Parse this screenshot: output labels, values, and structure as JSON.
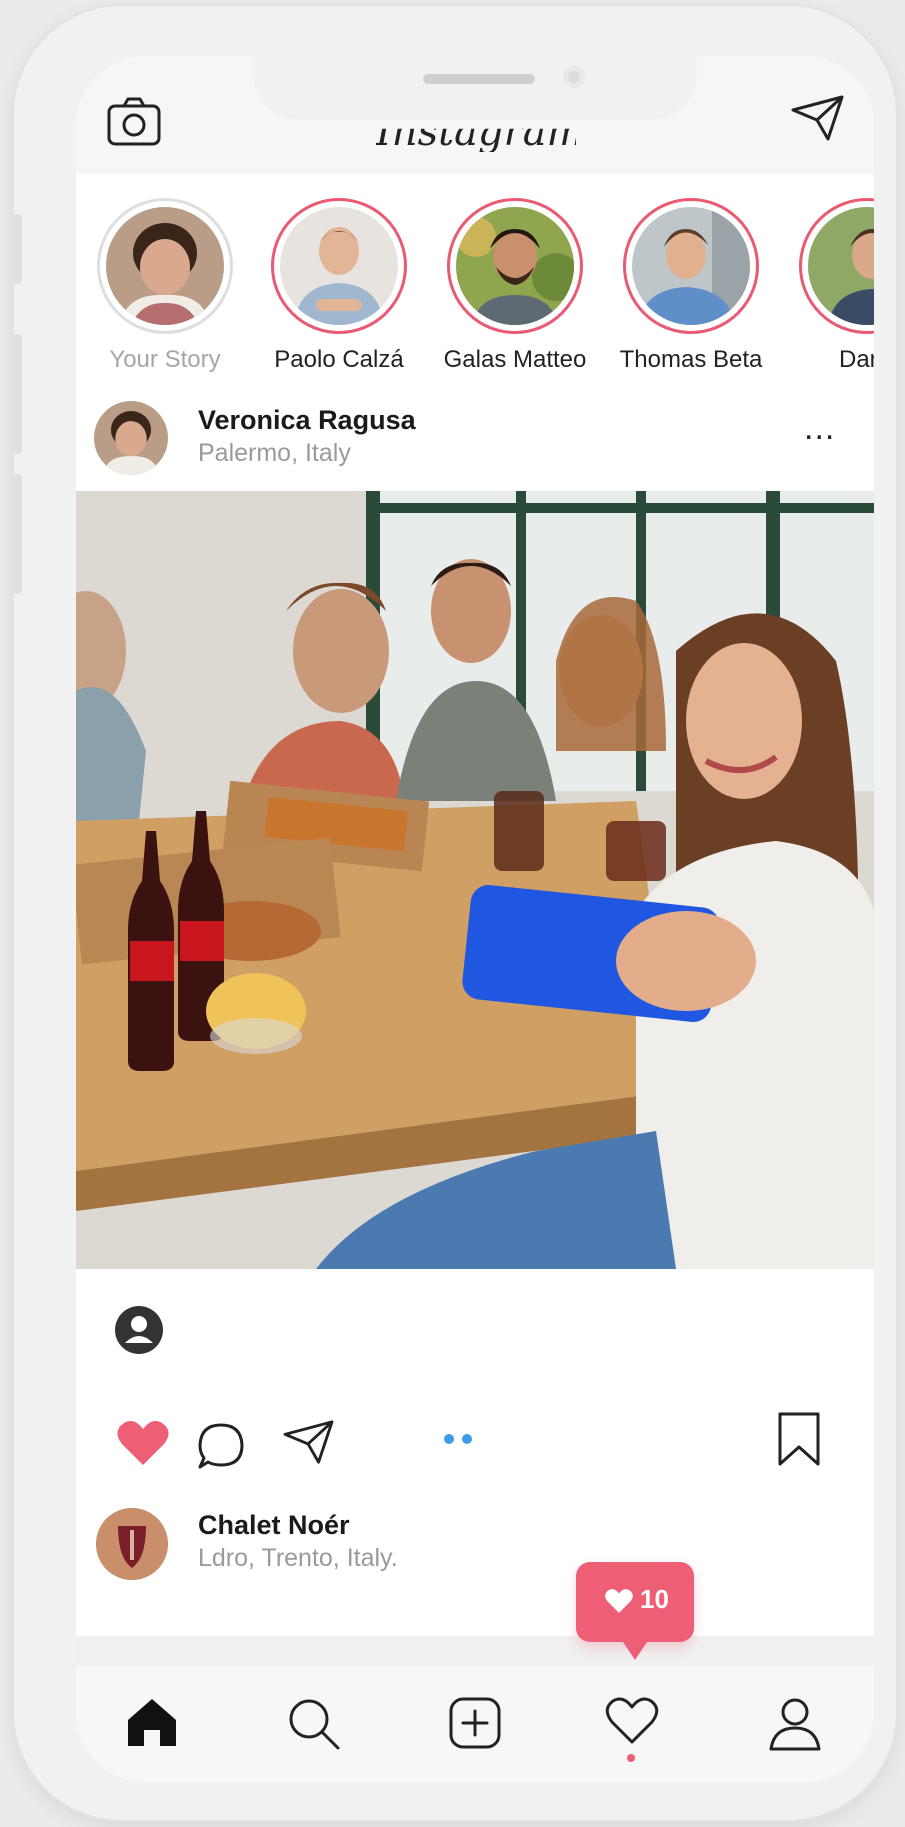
{
  "app": {
    "logo_text": "Instagram"
  },
  "stories": [
    {
      "name": "Your Story",
      "is_self": true
    },
    {
      "name": "Paolo Calzá"
    },
    {
      "name": "Galas Matteo"
    },
    {
      "name": "Thomas Beta"
    },
    {
      "name": "Dami"
    }
  ],
  "post": {
    "username": "Veronica Ragusa",
    "location": "Palermo,  Italy",
    "more_label": "..."
  },
  "post2": {
    "username": "Chalet Noér",
    "location": "Ldro, Trento,  Italy."
  },
  "notification": {
    "likes_count": "10"
  },
  "icons": {
    "camera": "camera-icon",
    "direct": "paper-plane-icon",
    "more": "more-icon",
    "like": "heart-icon",
    "comment": "comment-icon",
    "share": "paper-plane-icon",
    "save": "bookmark-icon",
    "home": "home-icon",
    "search": "search-icon",
    "add": "add-post-icon",
    "activity": "heart-icon",
    "profile": "profile-icon"
  },
  "colors": {
    "accent": "#ee5f76",
    "story_ring": "#ea5a72",
    "carousel_dot": "#3d9be9"
  }
}
